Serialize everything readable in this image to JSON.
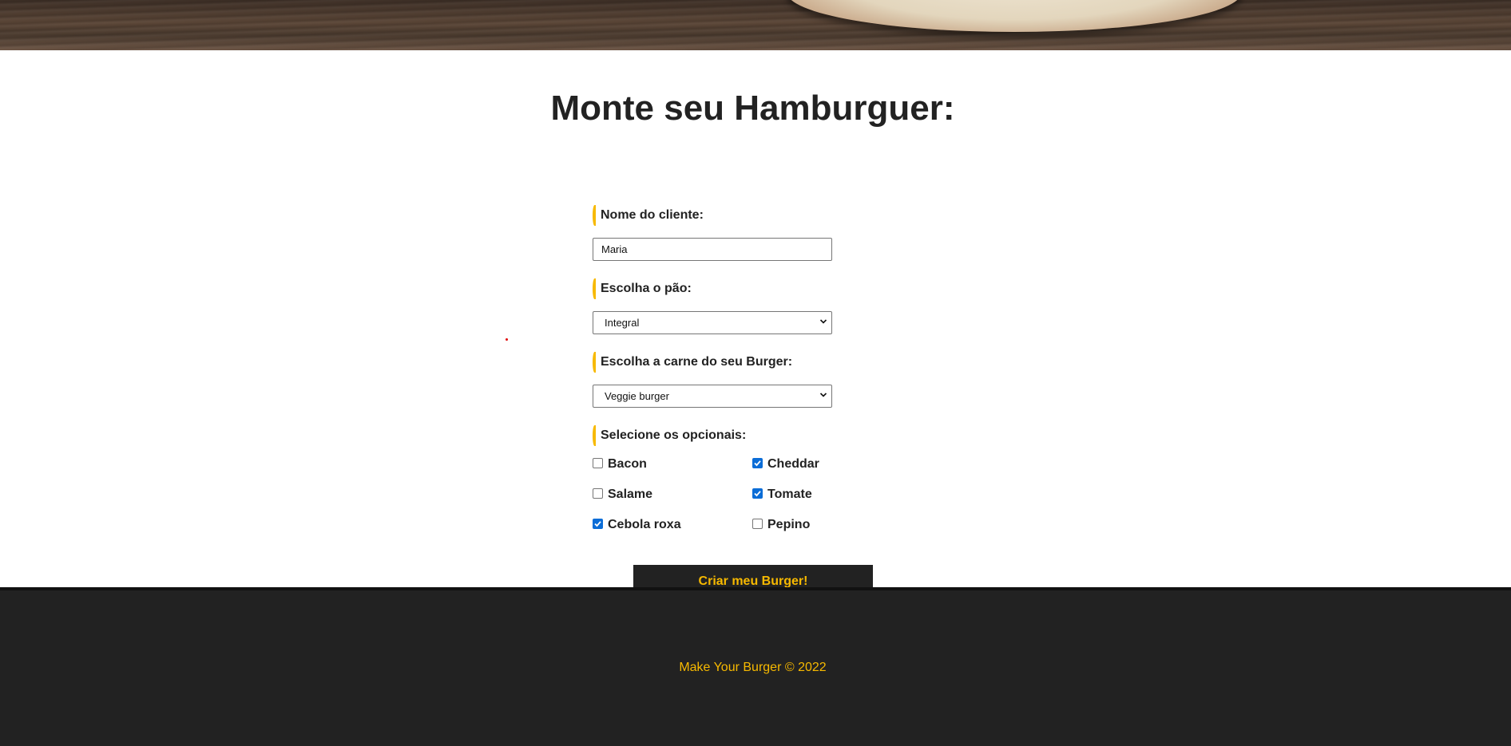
{
  "page": {
    "title": "Monte seu Hamburguer:"
  },
  "form": {
    "name_label": "Nome do cliente:",
    "name_value": "Maria",
    "bread_label": "Escolha o pão:",
    "bread_selected": "Integral",
    "meat_label": "Escolha a carne do seu Burger:",
    "meat_selected": "Veggie burger",
    "optionals_label": "Selecione os opcionais:",
    "optionals": [
      {
        "label": "Bacon",
        "checked": false
      },
      {
        "label": "Cheddar",
        "checked": true
      },
      {
        "label": "Salame",
        "checked": false
      },
      {
        "label": "Tomate",
        "checked": true
      },
      {
        "label": "Cebola roxa",
        "checked": true
      },
      {
        "label": "Pepino",
        "checked": false
      }
    ],
    "submit_label": "Criar meu Burger!"
  },
  "footer": {
    "text": "Make Your Burger © 2022"
  },
  "colors": {
    "accent": "#f7b900",
    "dark": "#222222",
    "checkbox": "#0b6dd7"
  },
  "icons": {
    "select_arrow": "chevron-down-icon",
    "checkmark": "checkmark-icon"
  }
}
